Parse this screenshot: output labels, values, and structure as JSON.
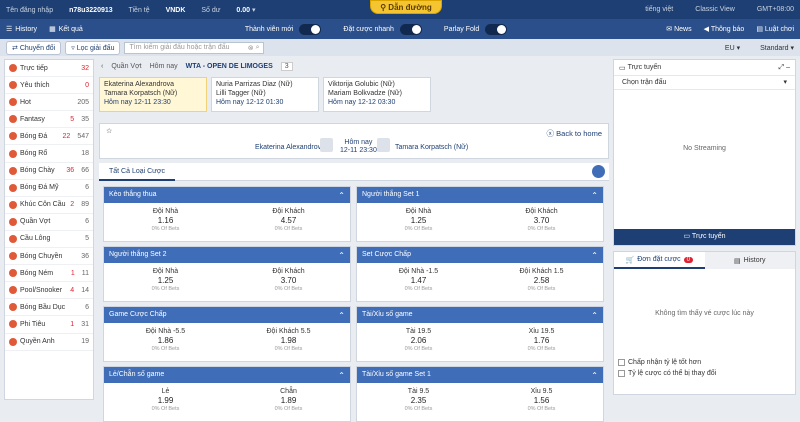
{
  "top": {
    "login_label": "Tên đăng nhập",
    "username": "n78u3220913",
    "currency_label": "Tiền tệ",
    "currency": "VNDK",
    "balance_label": "Số dư",
    "balance": "0.00",
    "lang": "tiếng việt",
    "view": "Classic View",
    "tz": "GMT+08:00",
    "banner": "Dẫn đường"
  },
  "nav": {
    "history": "History",
    "results": "Kết quả",
    "t1": "Thành viên mới",
    "t2": "Đặt cược nhanh",
    "t3": "Parlay Fold",
    "news": "News",
    "notice": "Thông báo",
    "rules": "Luật chơi"
  },
  "sbar": {
    "switch": "Chuyển đổi",
    "filter": "Lọc giải đấu",
    "search_ph": "Tìm kiếm giải đấu hoặc trận đấu",
    "odds_type": "EU",
    "mode": "Standard"
  },
  "sports": [
    {
      "n": "Trực tiếp",
      "c": "32",
      "red": true
    },
    {
      "n": "Yêu thích",
      "c": "0",
      "red": true
    },
    {
      "n": "Hot",
      "c": "205"
    },
    {
      "n": "Fantasy",
      "c": "5",
      "c2": "35"
    },
    {
      "n": "Bóng Đá",
      "c": "22",
      "c2": "547"
    },
    {
      "n": "Bóng Rổ",
      "c": "18"
    },
    {
      "n": "Bóng Chày",
      "c": "36",
      "c2": "66"
    },
    {
      "n": "Bóng Đá Mỹ",
      "c": "6"
    },
    {
      "n": "Khúc Côn Cầu",
      "c": "2",
      "c2": "89"
    },
    {
      "n": "Quần Vợt",
      "c": "6"
    },
    {
      "n": "Cầu Lông",
      "c": "5"
    },
    {
      "n": "Bóng Chuyền",
      "c": "36"
    },
    {
      "n": "Bóng Ném",
      "c": "1",
      "c2": "11"
    },
    {
      "n": "Pool/Snooker",
      "c": "4",
      "c2": "14"
    },
    {
      "n": "Bóng Bầu Dục",
      "c": "6"
    },
    {
      "n": "Phi Tiêu",
      "c": "1",
      "c2": "31"
    },
    {
      "n": "Quyền Anh",
      "c": "19"
    }
  ],
  "crumb": {
    "sport": "Quần Vợt",
    "day": "Hôm nay",
    "league": "WTA - OPEN DE LIMOGES",
    "count": "3"
  },
  "matches": [
    {
      "p1": "Ekaterina Alexandrova",
      "p2": "Tamara Korpatsch (Nữ)",
      "day": "Hôm nay",
      "time": "12-11 23:30"
    },
    {
      "p1": "Nuria Parrizas Diaz (Nữ)",
      "p2": "Lilli Tagger (Nữ)",
      "day": "Hôm nay",
      "time": "12-12 01:30"
    },
    {
      "p1": "Viktorija Golubic (Nữ)",
      "p2": "Mariam Bolkvadze (Nữ)",
      "day": "Hôm nay",
      "time": "12-12 03:30"
    }
  ],
  "hero": {
    "p1": "Ekaterina Alexandrova",
    "p2": "Tamara Korpatsch (Nữ)",
    "day": "Hôm nay",
    "time": "12-11 23:30",
    "back": "Back to home"
  },
  "tab": "Tất Cả Loại Cược",
  "markets": [
    {
      "t": "Kèo thắng thua",
      "o": [
        {
          "l": "Đội Nhà",
          "v": "1.16",
          "p": "0% Of Bets"
        },
        {
          "l": "Đội Khách",
          "v": "4.57",
          "p": "0% Of Bets"
        }
      ]
    },
    {
      "t": "Người thắng Set 1",
      "o": [
        {
          "l": "Đội Nhà",
          "v": "1.25",
          "p": "0% Of Bets"
        },
        {
          "l": "Đội Khách",
          "v": "3.70",
          "p": "0% Of Bets"
        }
      ]
    },
    {
      "t": "Người thắng Set 2",
      "o": [
        {
          "l": "Đội Nhà",
          "v": "1.25",
          "p": "0% Of Bets"
        },
        {
          "l": "Đội Khách",
          "v": "3.70",
          "p": "0% Of Bets"
        }
      ]
    },
    {
      "t": "Set Cược Chấp",
      "o": [
        {
          "l": "Đội Nhà -1.5",
          "v": "1.47",
          "p": "0% Of Bets"
        },
        {
          "l": "Đội Khách 1.5",
          "v": "2.58",
          "p": "0% Of Bets"
        }
      ]
    },
    {
      "t": "Game Cược Chấp",
      "o": [
        {
          "l": "Đội Nhà -5.5",
          "v": "1.86",
          "p": "0% Of Bets"
        },
        {
          "l": "Đội Khách 5.5",
          "v": "1.98",
          "p": "0% Of Bets"
        }
      ]
    },
    {
      "t": "Tài/Xỉu số game",
      "o": [
        {
          "l": "Tài 19.5",
          "v": "2.06",
          "p": "0% Of Bets"
        },
        {
          "l": "Xỉu 19.5",
          "v": "1.76",
          "p": "0% Of Bets"
        }
      ]
    },
    {
      "t": "Lẻ/Chẵn số game",
      "o": [
        {
          "l": "Lẻ",
          "v": "1.99",
          "p": "0% Of Bets"
        },
        {
          "l": "Chẵn",
          "v": "1.89",
          "p": "0% Of Bets"
        }
      ]
    },
    {
      "t": "Tài/Xỉu số game Set 1",
      "o": [
        {
          "l": "Tài 9.5",
          "v": "2.35",
          "p": "0% Of Bets"
        },
        {
          "l": "Xỉu 9.5",
          "v": "1.56",
          "p": "0% Of Bets"
        }
      ]
    }
  ],
  "right": {
    "live": "Trực tuyến",
    "choose": "Chọn trận đấu",
    "nostream": "No Streaming",
    "live_btn": "Trực tuyến",
    "slip": "Đơn đặt cược",
    "slip_count": "0",
    "history": "History",
    "empty": "Không tìm thấy vé cược lúc này",
    "c1": "Chấp nhận tỷ lệ tốt hơn",
    "c2": "Tỷ lệ cược có thể bị thay đổi"
  }
}
